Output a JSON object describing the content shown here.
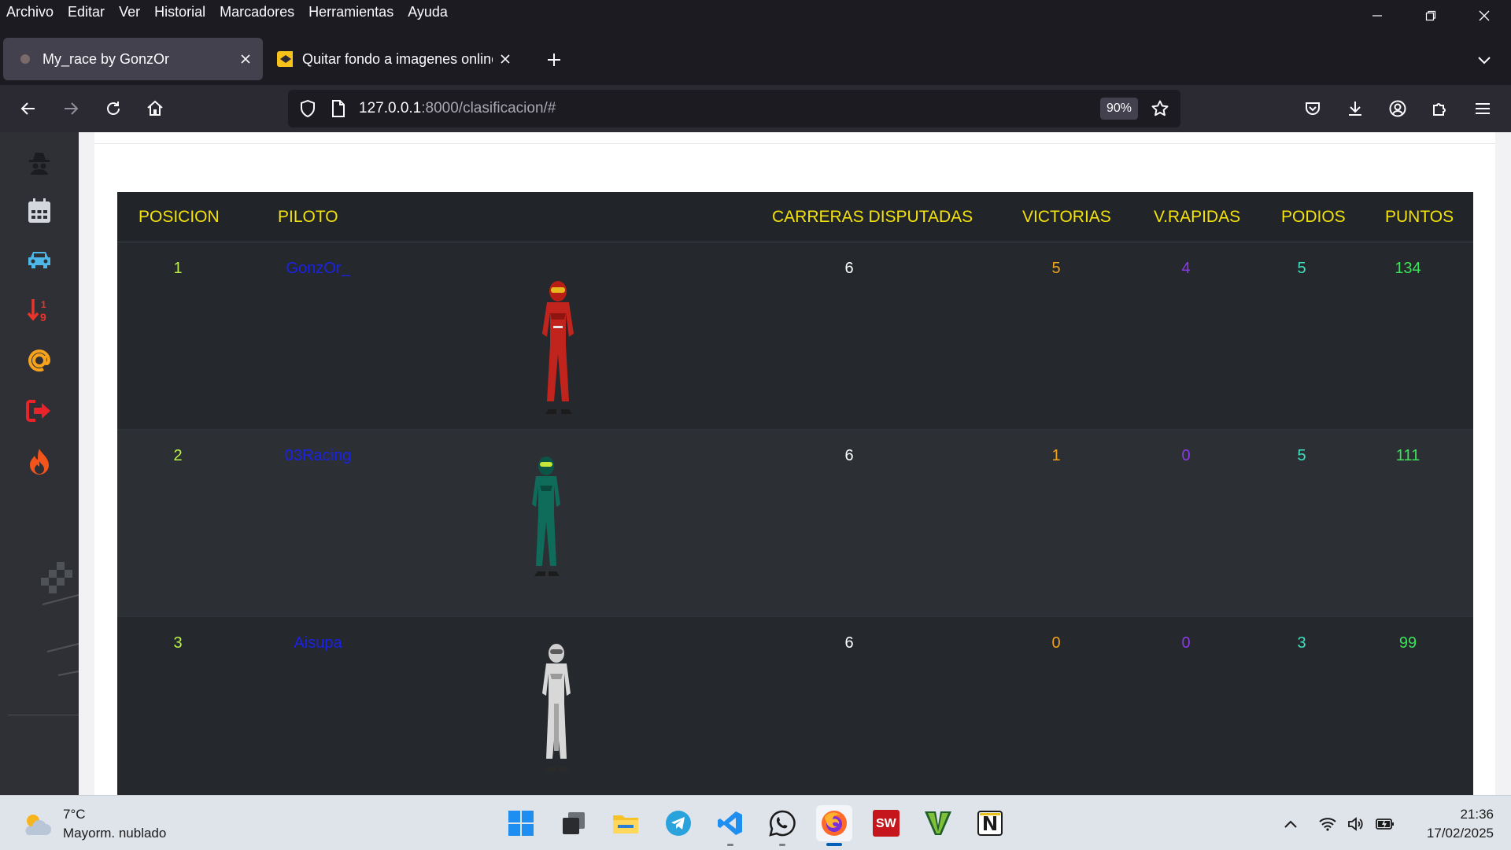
{
  "menu": [
    "Archivo",
    "Editar",
    "Ver",
    "Historial",
    "Marcadores",
    "Herramientas",
    "Ayuda"
  ],
  "tabs": [
    {
      "title": "My_race by GonzOr",
      "active": true
    },
    {
      "title": "Quitar fondo a imagenes online",
      "active": false
    }
  ],
  "url": {
    "host": "127.0.0.1",
    "rest": ":8000/clasificacion/#"
  },
  "zoom": "90%",
  "sidebar_icons": [
    "spy-icon",
    "calendar-icon",
    "car-icon",
    "sort-icon",
    "at-icon",
    "logout-icon",
    "fire-icon"
  ],
  "table": {
    "headers": {
      "posicion": "POSICION",
      "piloto": "PILOTO",
      "carreras": "CARRERAS DISPUTADAS",
      "victorias": "VICTORIAS",
      "vrapidas": "V.RAPIDAS",
      "podios": "PODIOS",
      "puntos": "PUNTOS"
    },
    "rows": [
      {
        "pos": "1",
        "piloto": "GonzOr_",
        "carreras": "6",
        "victorias": "5",
        "vrapidas": "4",
        "podios": "5",
        "puntos": "134",
        "suit": "#c0241c"
      },
      {
        "pos": "2",
        "piloto": "03Racing",
        "carreras": "6",
        "victorias": "1",
        "vrapidas": "0",
        "podios": "5",
        "puntos": "111",
        "suit": "#0f6b5a"
      },
      {
        "pos": "3",
        "piloto": "Aisupa",
        "carreras": "6",
        "victorias": "0",
        "vrapidas": "0",
        "podios": "3",
        "puntos": "99",
        "suit": "#d8d8d8"
      }
    ]
  },
  "taskbar": {
    "weather": {
      "temp": "7°C",
      "desc": "Mayorm. nublado"
    },
    "clock": {
      "time": "21:36",
      "date": "17/02/2025"
    },
    "apps": [
      "windows-start-icon",
      "task-view-icon",
      "file-explorer-icon",
      "telegram-icon",
      "vscode-icon",
      "whatsapp-icon",
      "firefox-icon",
      "solidworks-icon",
      "gta-icon",
      "notion-icon"
    ],
    "solidworks_badge": "SW"
  },
  "colors": {
    "header_text": "#f4e20c",
    "pos": "#b9f24a",
    "piloto": "#1a22e8",
    "victorias": "#f0a21b",
    "vrapidas": "#8a3be8",
    "podios": "#3fe0c0",
    "puntos": "#3ce35a"
  }
}
